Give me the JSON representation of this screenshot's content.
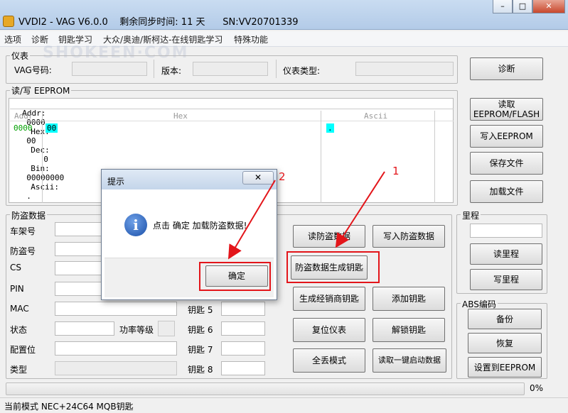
{
  "window": {
    "title": "VVDI2 - VAG V6.0.0    剩余同步时间: 11 天      SN:VV20701339",
    "controls": {
      "minimize": "–",
      "maximize": "□",
      "close": "✕"
    }
  },
  "menu": [
    "选项",
    "诊断",
    "钥匙学习",
    "大众/奥迪/斯柯达-在线钥匙学习",
    "特殊功能"
  ],
  "watermark": "SHOKEEN·COM",
  "cluster": {
    "legend": "仪表",
    "vag_code_label": "VAG号码:",
    "version_label": "版本:",
    "type_label": "仪表类型:",
    "diagnose_button": "诊断"
  },
  "eeprom": {
    "legend": "读/写 EEPROM",
    "status": {
      "addr_label": "Addr:",
      "addr": "0000",
      "hex_label": "Hex:",
      "hex": "00",
      "dec_label": "Dec:",
      "dec": "0",
      "bin_label": "Bin:",
      "bin": "00000000",
      "ascii_label": "Ascii:",
      "ascii": "."
    },
    "columns": [
      "Addr",
      "Hex",
      "Ascii"
    ],
    "row": {
      "addr": "0000",
      "hex": "00",
      "ascii": "."
    },
    "buttons": {
      "read": "读取\nEEPROM/FLASH",
      "write": "写入EEPROM",
      "save": "保存文件",
      "load": "加载文件"
    }
  },
  "immo": {
    "legend": "防盗数据",
    "labels": [
      "车架号",
      "防盗号",
      "CS",
      "PIN",
      "MAC",
      "状态",
      "配置位",
      "类型"
    ],
    "power_label": "功率等级",
    "keys": [
      "钥匙 5",
      "钥匙 6",
      "钥匙 7",
      "钥匙 8"
    ],
    "buttons": {
      "read_immo": "读防盗数据",
      "write_immo": "写入防盗数据",
      "gen_key": "防盗数据生成钥匙",
      "gen_dealer_key": "生成经销商钥匙",
      "add_key": "添加钥匙",
      "reset_cluster": "复位仪表",
      "unlock_key": "解锁钥匙",
      "all_lost": "全丢模式",
      "read_start_data": "读取一键启动数据"
    }
  },
  "odometer": {
    "legend": "里程",
    "read": "读里程",
    "write": "写里程"
  },
  "abs": {
    "legend": "ABS编码",
    "backup": "备份",
    "restore": "恢复",
    "set_eeprom": "设置到EEPROM"
  },
  "progress": {
    "value": 0,
    "label": "0%"
  },
  "statusbar": {
    "text": "当前模式 NEC+24C64 MQB钥匙"
  },
  "dialog": {
    "title": "提示",
    "close": "✕",
    "message": "点击 确定 加载防盗数据!",
    "ok": "确定"
  },
  "annotations": {
    "one": "1",
    "two": "2"
  },
  "colors": {
    "annotation_red": "#e3151a",
    "cyan_cell": "#00ffff",
    "addr_green": "#00a000"
  }
}
